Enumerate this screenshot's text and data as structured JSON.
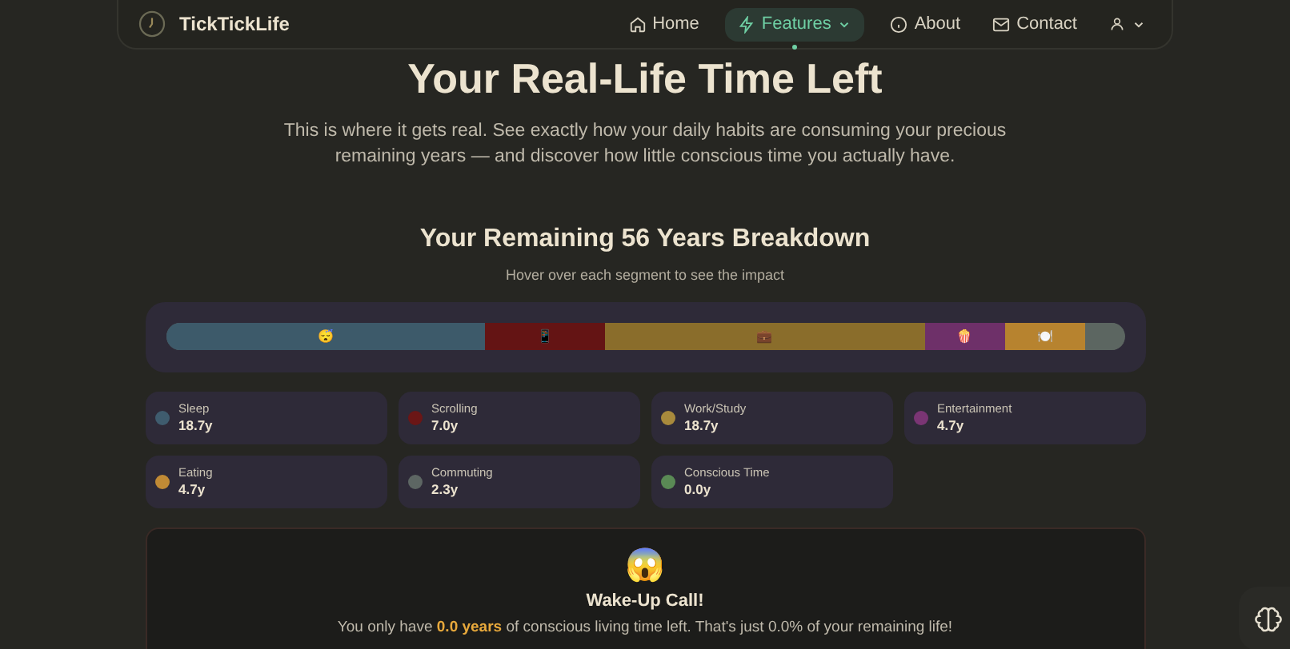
{
  "nav": {
    "brand": "TickTickLife",
    "links": [
      {
        "label": "Home",
        "selected": false,
        "dropdown": false
      },
      {
        "label": "Features",
        "selected": true,
        "dropdown": true
      },
      {
        "label": "About",
        "selected": false,
        "dropdown": false
      },
      {
        "label": "Contact",
        "selected": false,
        "dropdown": false
      }
    ]
  },
  "title": "Your Real-Life Time Left",
  "intro": "This is where it gets real. See exactly how your daily habits are consuming your precious remaining years — and discover how little conscious time you actually have.",
  "breakdown": {
    "title": "Your Remaining 56 Years Breakdown",
    "hint": "Hover over each segment to see the impact",
    "segments": [
      {
        "emoji": "😴",
        "color": "#3d5a6a"
      },
      {
        "emoji": "📱",
        "color": "#641414"
      },
      {
        "emoji": "💼",
        "color": "#8a6d2b"
      },
      {
        "emoji": "🍿",
        "color": "#6e3069"
      },
      {
        "emoji": "🍽️",
        "color": "#b7832f"
      },
      {
        "color": "#5c6661"
      }
    ],
    "legend": [
      {
        "label": "Sleep",
        "value": "18.7y",
        "color": "#3f5c6e"
      },
      {
        "label": "Scrolling",
        "value": "7.0y",
        "color": "#6b1616"
      },
      {
        "label": "Work/Study",
        "value": "18.7y",
        "color": "#a88a3c"
      },
      {
        "label": "Entertainment",
        "value": "4.7y",
        "color": "#7a3574"
      },
      {
        "label": "Eating",
        "value": "4.7y",
        "color": "#c08a35"
      },
      {
        "label": "Commuting",
        "value": "2.3y",
        "color": "#5d6663"
      },
      {
        "label": "Conscious Time",
        "value": "0.0y",
        "color": "#5a8a55"
      }
    ]
  },
  "alert": {
    "emoji": "😱",
    "title": "Wake-Up Call!",
    "text": "You only have **0.0 years** of conscious living time left. That's just 0.0% of your remaining life!"
  }
}
